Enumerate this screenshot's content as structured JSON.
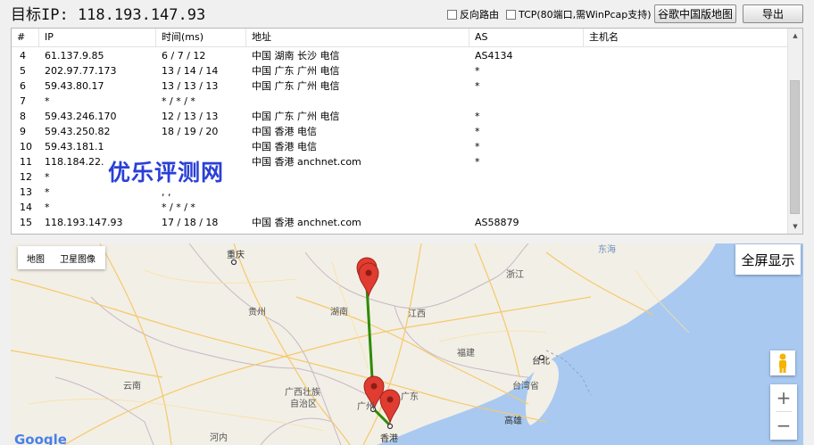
{
  "toolbar": {
    "target_label": "目标IP: 118.193.147.93",
    "reverse_route_label": "反向路由",
    "tcp_label": "TCP(80端口,需WinPcap支持)",
    "google_map_button": "谷歌中国版地图",
    "export_button": "导出"
  },
  "table": {
    "columns": [
      "#",
      "IP",
      "时间(ms)",
      "地址",
      "AS",
      "主机名"
    ],
    "rows": [
      {
        "n": "4",
        "ip": "61.137.9.85",
        "time": "6 / 7 / 12",
        "addr": "中国 湖南 长沙 电信",
        "as": "AS4134",
        "host": ""
      },
      {
        "n": "5",
        "ip": "202.97.77.173",
        "time": "13 / 14 / 14",
        "addr": "中国 广东 广州 电信",
        "as": "*",
        "host": ""
      },
      {
        "n": "6",
        "ip": "59.43.80.17",
        "time": "13 / 13 / 13",
        "addr": "中国 广东 广州 电信",
        "as": "*",
        "host": ""
      },
      {
        "n": "7",
        "ip": "*",
        "time": "* / * / *",
        "addr": "",
        "as": "",
        "host": ""
      },
      {
        "n": "8",
        "ip": "59.43.246.170",
        "time": "12 / 13 / 13",
        "addr": "中国 广东 广州 电信",
        "as": "*",
        "host": ""
      },
      {
        "n": "9",
        "ip": "59.43.250.82",
        "time": "18 / 19 / 20",
        "addr": "中国 香港 电信",
        "as": "*",
        "host": ""
      },
      {
        "n": "10",
        "ip": "59.43.181.1",
        "time": "",
        "addr": "中国 香港 电信",
        "as": "*",
        "host": ""
      },
      {
        "n": "11",
        "ip": "118.184.22.",
        "time": "",
        "addr": "中国 香港 anchnet.com",
        "as": "*",
        "host": ""
      },
      {
        "n": "12",
        "ip": "*",
        "time": "",
        "addr": "",
        "as": "",
        "host": ""
      },
      {
        "n": "13",
        "ip": "*",
        "time": ", ,",
        "addr": "",
        "as": "",
        "host": ""
      },
      {
        "n": "14",
        "ip": "*",
        "time": "* / * / *",
        "addr": "",
        "as": "",
        "host": ""
      },
      {
        "n": "15",
        "ip": "118.193.147.93",
        "time": "17 / 18 / 18",
        "addr": "中国 香港 anchnet.com",
        "as": "AS58879",
        "host": ""
      }
    ]
  },
  "watermark": "优乐评测网",
  "map": {
    "type_map": "地图",
    "type_satellite": "卫星图像",
    "fullscreen": "全屏显示",
    "zoom_in": "+",
    "zoom_out": "−",
    "google_logo": "Google",
    "labels": [
      "重庆",
      "贵州",
      "湖南",
      "江西",
      "浙江",
      "福建",
      "台北",
      "台湾省",
      "高雄",
      "云南",
      "广西壮族",
      "自治区",
      "广东",
      "香港",
      "河内",
      "广州",
      "东海"
    ],
    "route_color": "#2e8b00",
    "marker_color": "#e03c31"
  }
}
